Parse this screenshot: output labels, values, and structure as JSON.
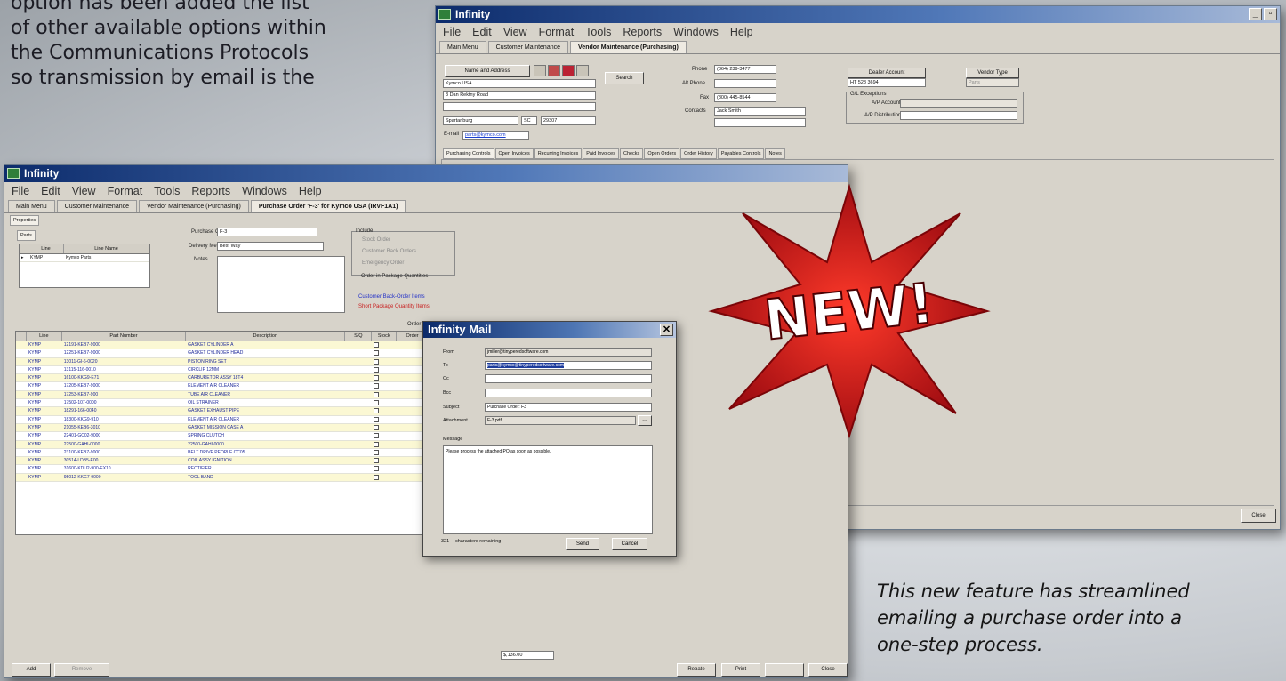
{
  "page_text": [
    "option has been added the list",
    "of other available options within",
    "the Communications Protocols",
    "so transmission by email is the"
  ],
  "caption": [
    "This new feature has streamlined",
    "emailing a purchase order into a",
    "one-step process."
  ],
  "back_window": {
    "title": "Infinity",
    "menu": [
      "File",
      "Edit",
      "View",
      "Format",
      "Tools",
      "Reports",
      "Windows",
      "Help"
    ],
    "tabs": [
      "Main Menu",
      "Customer Maintenance",
      "Vendor Maintenance (Purchasing)"
    ],
    "name_address_label": "Name and Address",
    "search_label": "Search",
    "name_value": "Kymco USA",
    "address1": "3 Dan Rektny Road",
    "city": "Spartanburg",
    "state": "SC",
    "zip": "29307",
    "email_label": "E-mail",
    "email_value": "parts@kymco.com",
    "phone_label": "Phone",
    "phone_value": "(864) 239-3477",
    "alt_phone_label": "Alt Phone",
    "fax_label": "Fax",
    "fax_value": "(800) 445-8544",
    "contacts_label": "Contacts",
    "contacts_value": "Jack Smith",
    "dealer_account_label": "Dealer Account",
    "dealer_account_value": "HT 528 3694",
    "vendor_type_label": "Vendor Type",
    "vendor_type_value": "Parts",
    "gl_exceptions_label": "G/L Exceptions",
    "ap_account_label": "A/P Account",
    "ap_distribution_label": "A/P Distribution",
    "subtabs": [
      "Purchasing Controls",
      "Open Invoices",
      "Recurring Invoices",
      "Paid Invoices",
      "Checks",
      "Open Orders",
      "Order History",
      "Payables Controls",
      "Notes"
    ],
    "close_label": "Close"
  },
  "front_window": {
    "title": "Infinity",
    "menu": [
      "File",
      "Edit",
      "View",
      "Format",
      "Tools",
      "Reports",
      "Windows",
      "Help"
    ],
    "tabs": [
      "Main Menu",
      "Customer Maintenance",
      "Vendor Maintenance (Purchasing)",
      "Purchase Order 'F-3' for Kymco USA (IRVF1A1)"
    ],
    "properties_tab": "Properties",
    "parts_tab": "Parts",
    "line_header": "Line",
    "line_name_header": "Line Name",
    "line_code": "KYMP",
    "line_name": "Kymco Parts",
    "purchase_order_label": "Purchase Order",
    "purchase_order_value": "F-3",
    "delivery_method_label": "Delivery Method",
    "delivery_method_value": "Best Way",
    "notes_label": "Notes",
    "include_label": "Include",
    "include_items": [
      "Stock Order",
      "Customer Back Orders",
      "Emergency Order"
    ],
    "order_in_package_label": "Order in Package Quantities",
    "legend_back_order": "Customer Back-Order Items",
    "legend_short_package": "Short Package Quantity Items",
    "order_col_label": "Order Co",
    "grid_headers": [
      "Line",
      "Part Number",
      "Description",
      "S/Q",
      "Stock",
      "Order"
    ],
    "rows": [
      {
        "line": "KYMP",
        "part": "12191-KEB7-9000",
        "desc": "GASKET CYLINDER A"
      },
      {
        "line": "KYMP",
        "part": "12251-KEB7-9000",
        "desc": "GASKET CYLINDER HEAD"
      },
      {
        "line": "KYMP",
        "part": "13011-GI-6-0020",
        "desc": "PISTON RING SET"
      },
      {
        "line": "KYMP",
        "part": "13115-116-0010",
        "desc": "CIRCLIP 12MM"
      },
      {
        "line": "KYMP",
        "part": "16100-KKG9-E71",
        "desc": "CARBURETOR ASSY 18T4"
      },
      {
        "line": "KYMP",
        "part": "17205-KEB7-9000",
        "desc": "ELEMENT AIR CLEANER"
      },
      {
        "line": "KYMP",
        "part": "17253-KEB7-900",
        "desc": "TUBE AIR CLEANER"
      },
      {
        "line": "KYMP",
        "part": "17502-107-0000",
        "desc": "OIL STRAINER"
      },
      {
        "line": "KYMP",
        "part": "18291-166-0040",
        "desc": "GASKET EXHAUST PIPE"
      },
      {
        "line": "KYMP",
        "part": "18300-KKG9-910",
        "desc": "ELEMENT AIR CLEANER"
      },
      {
        "line": "KYMP",
        "part": "21055-KEB6-3010",
        "desc": "GASKET MISSION CASE A"
      },
      {
        "line": "KYMP",
        "part": "22401-GC02-9000",
        "desc": "SPRING CLUTCH"
      },
      {
        "line": "KYMP",
        "part": "22500-GAHI-0000",
        "desc": "22500-GAHI-0000"
      },
      {
        "line": "KYMP",
        "part": "23100-KEB7-9000",
        "desc": "BELT DRIVE PEOPLE CC05"
      },
      {
        "line": "KYMP",
        "part": "30514-LDB5-E00",
        "desc": "COIL ASSY IGNITION"
      },
      {
        "line": "KYMP",
        "part": "31600-KDU2-900-EX10",
        "desc": "RECTIFIER"
      },
      {
        "line": "KYMP",
        "part": "95012-KKG7-9000",
        "desc": "TOOL BAND"
      }
    ],
    "total_value": "$,136.00",
    "add_label": "Add",
    "remove_label": "Remove",
    "rebate_label": "Rebate",
    "print_label": "Print",
    "close_label": "Close"
  },
  "mail": {
    "title": "Infinity Mail",
    "from_label": "From",
    "from_value": "jmiller@tinyperedsoftware.com",
    "to_label": "To",
    "to_value": "parts@kymco@tinyperedsoftware.com",
    "cc_label": "Cc",
    "bcc_label": "Bcc",
    "subject_label": "Subject",
    "subject_value": "Purchase Order: F3",
    "attachment_label": "Attachment",
    "attachment_value": "F-3.pdf",
    "message_label": "Message",
    "message_value": "Please process the attached PO as soon as possible.",
    "chars_count": "321",
    "chars_label": "characters remaining",
    "send_label": "Send",
    "cancel_label": "Cancel"
  },
  "burst": {
    "text": "NEW!",
    "color": "#d4141a"
  }
}
